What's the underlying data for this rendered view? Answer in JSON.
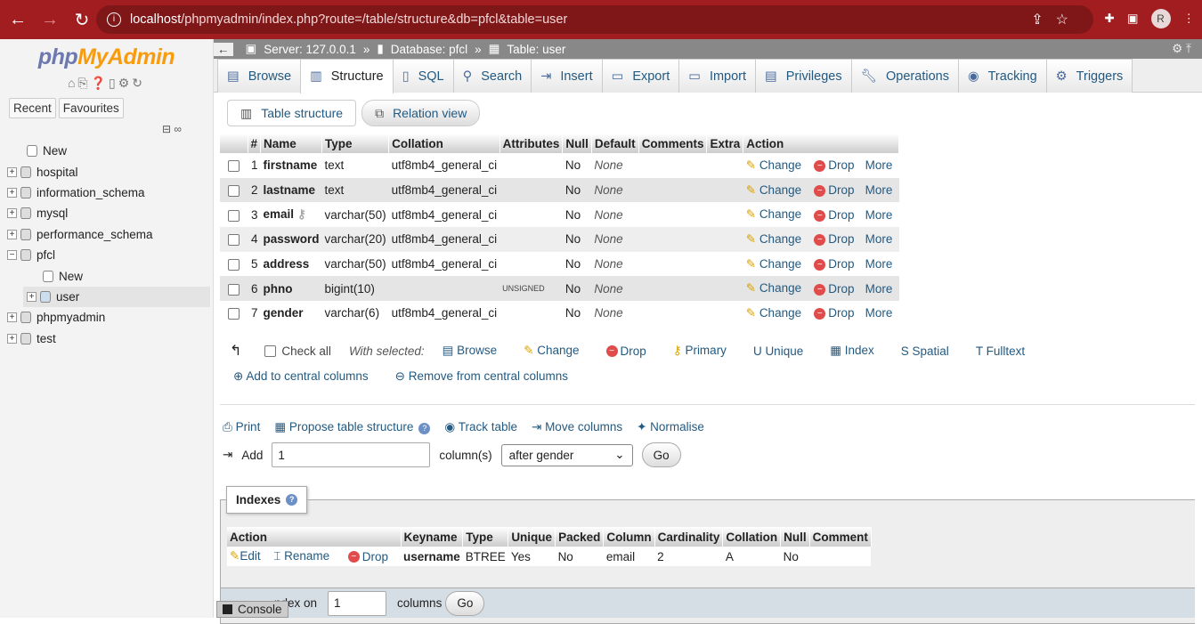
{
  "browser": {
    "url_host": "localhost",
    "url_path": "/phpmyadmin/index.php?route=/table/structure&db=pfcl&table=user",
    "avatar": "R"
  },
  "sidebar": {
    "logo_php": "php",
    "logo_myadmin": "MyAdmin",
    "recent": "Recent",
    "favourites": "Favourites",
    "tree": [
      {
        "label": "New",
        "level": 0
      },
      {
        "label": "hospital",
        "level": 0
      },
      {
        "label": "information_schema",
        "level": 0
      },
      {
        "label": "mysql",
        "level": 0
      },
      {
        "label": "performance_schema",
        "level": 0
      },
      {
        "label": "pfcl",
        "level": 0
      },
      {
        "label": "New",
        "level": 1
      },
      {
        "label": "user",
        "level": 1
      },
      {
        "label": "phpmyadmin",
        "level": 0
      },
      {
        "label": "test",
        "level": 0
      }
    ]
  },
  "breadcrumb": {
    "server": "Server: 127.0.0.1",
    "database": "Database: pfcl",
    "table": "Table: user"
  },
  "tabs": [
    "Browse",
    "Structure",
    "SQL",
    "Search",
    "Insert",
    "Export",
    "Import",
    "Privileges",
    "Operations",
    "Tracking",
    "Triggers"
  ],
  "subtabs": {
    "structure": "Table structure",
    "relation": "Relation view"
  },
  "columns_table": {
    "headers": [
      "#",
      "Name",
      "Type",
      "Collation",
      "Attributes",
      "Null",
      "Default",
      "Comments",
      "Extra",
      "Action"
    ],
    "rows": [
      {
        "n": "1",
        "name": "firstname",
        "type": "text",
        "collation": "utf8mb4_general_ci",
        "attributes": "",
        "null": "No",
        "default": "None"
      },
      {
        "n": "2",
        "name": "lastname",
        "type": "text",
        "collation": "utf8mb4_general_ci",
        "attributes": "",
        "null": "No",
        "default": "None"
      },
      {
        "n": "3",
        "name": "email",
        "type": "varchar(50)",
        "collation": "utf8mb4_general_ci",
        "attributes": "",
        "null": "No",
        "default": "None"
      },
      {
        "n": "4",
        "name": "password",
        "type": "varchar(20)",
        "collation": "utf8mb4_general_ci",
        "attributes": "",
        "null": "No",
        "default": "None"
      },
      {
        "n": "5",
        "name": "address",
        "type": "varchar(50)",
        "collation": "utf8mb4_general_ci",
        "attributes": "",
        "null": "No",
        "default": "None"
      },
      {
        "n": "6",
        "name": "phno",
        "type": "bigint(10)",
        "collation": "",
        "attributes": "UNSIGNED",
        "null": "No",
        "default": "None"
      },
      {
        "n": "7",
        "name": "gender",
        "type": "varchar(6)",
        "collation": "utf8mb4_general_ci",
        "attributes": "",
        "null": "No",
        "default": "None"
      }
    ],
    "actions": {
      "change": "Change",
      "drop": "Drop",
      "more": "More"
    }
  },
  "with_selected": {
    "check_all": "Check all",
    "label": "With selected:",
    "items": [
      "Browse",
      "Change",
      "Drop",
      "Primary",
      "Unique",
      "Index",
      "Spatial",
      "Fulltext"
    ],
    "add_central": "Add to central columns",
    "remove_central": "Remove from central columns"
  },
  "tools": {
    "print": "Print",
    "propose": "Propose table structure",
    "track": "Track table",
    "move": "Move columns",
    "normalise": "Normalise"
  },
  "add_columns": {
    "label": "Add",
    "value": "1",
    "unit": "column(s)",
    "position": "after gender",
    "go": "Go"
  },
  "indexes": {
    "title": "Indexes",
    "headers": [
      "Action",
      "Keyname",
      "Type",
      "Unique",
      "Packed",
      "Column",
      "Cardinality",
      "Collation",
      "Null",
      "Comment"
    ],
    "row": {
      "edit": "Edit",
      "rename": "Rename",
      "drop": "Drop",
      "keyname": "username",
      "type": "BTREE",
      "unique": "Yes",
      "packed": "No",
      "column": "email",
      "cardinality": "2",
      "collation": "A",
      "null": "No",
      "comment": ""
    },
    "create_label": "ndex on",
    "create_value": "1",
    "create_unit": "columns",
    "go": "Go"
  },
  "console": "Console"
}
